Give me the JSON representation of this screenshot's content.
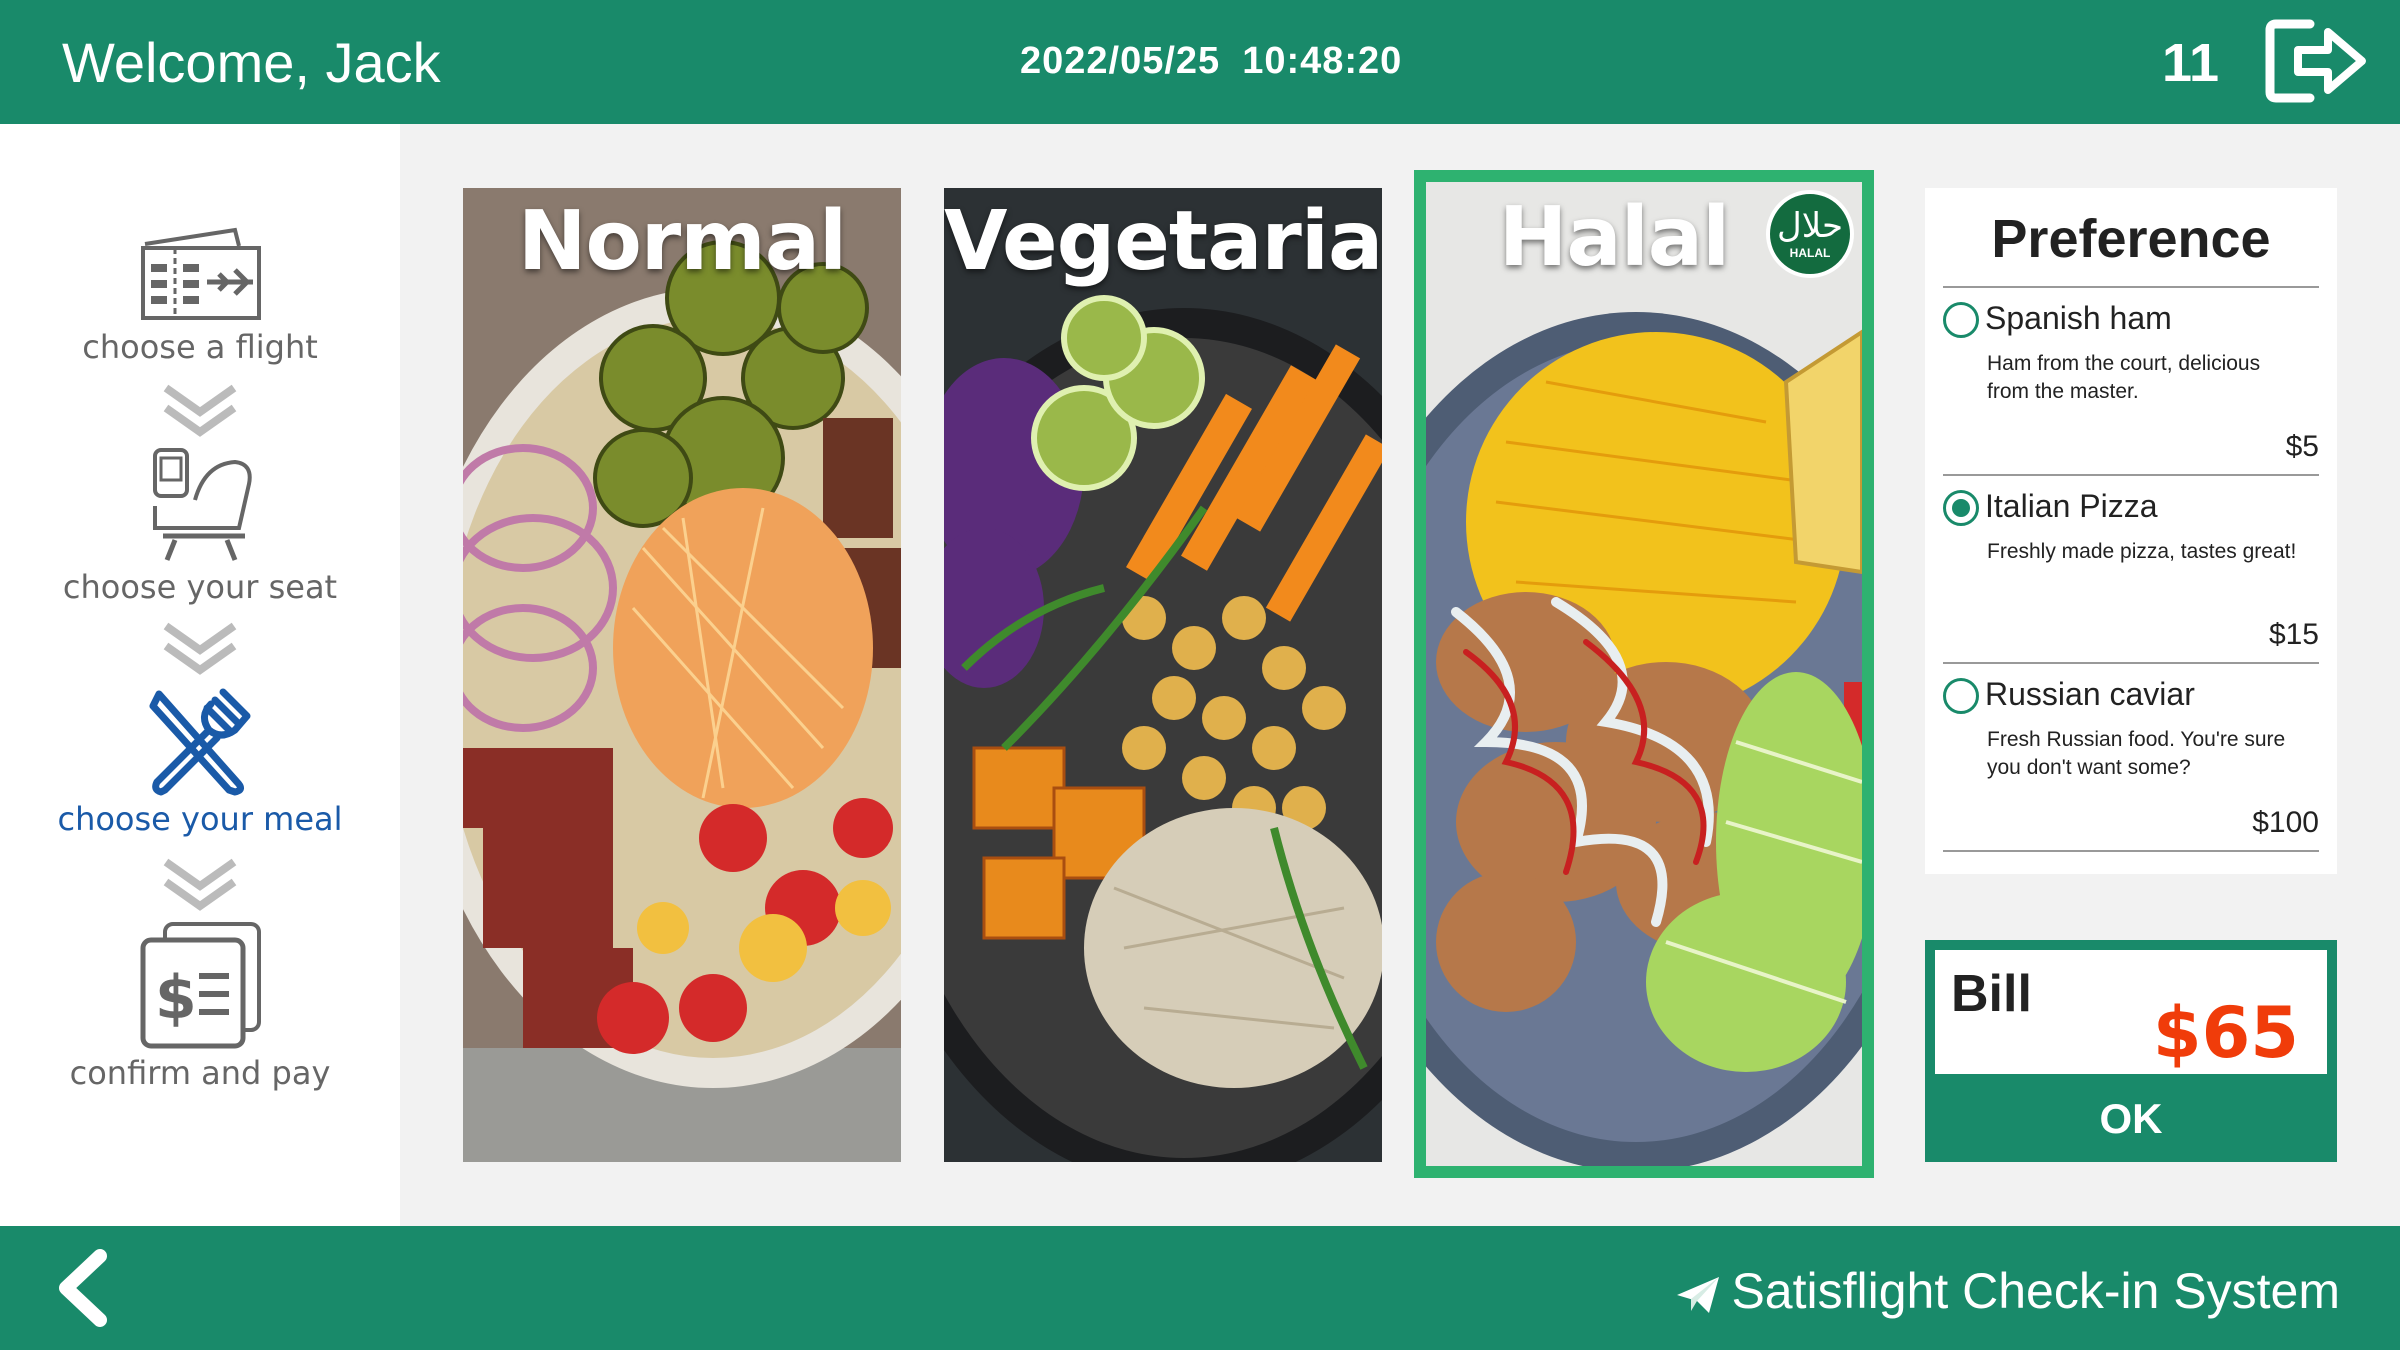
{
  "header": {
    "welcome": "Welcome, Jack",
    "date": "2022/05/25",
    "time": "10:48:20",
    "counter": "11",
    "logout_icon": "logout-icon"
  },
  "steps": [
    {
      "label": "choose a flight",
      "icon": "ticket-icon",
      "active": false
    },
    {
      "label": "choose your seat",
      "icon": "seat-icon",
      "active": false
    },
    {
      "label": "choose your meal",
      "icon": "fork-knife-icon",
      "active": true
    },
    {
      "label": "confirm and pay",
      "icon": "bill-icon",
      "active": false
    }
  ],
  "meals": [
    {
      "title": "Normal",
      "selected": false
    },
    {
      "title": "Vegetarian",
      "selected": false
    },
    {
      "title": "Halal",
      "selected": true,
      "badge_ar": "حلال",
      "badge_en": "HALAL"
    }
  ],
  "preference": {
    "title": "Preference",
    "options": [
      {
        "name": "Spanish ham",
        "desc": "Ham from the court, delicious from the master.",
        "price": "$5",
        "checked": false
      },
      {
        "name": "Italian Pizza",
        "desc": "Freshly made pizza, tastes great!",
        "price": "$15",
        "checked": true
      },
      {
        "name": "Russian caviar",
        "desc": "Fresh Russian food. You're sure you don't want some?",
        "price": "$100",
        "checked": false
      }
    ]
  },
  "bill": {
    "label": "Bill",
    "amount": "$65",
    "ok_label": "OK"
  },
  "footer": {
    "brand": "Satisflight Check-in System"
  },
  "colors": {
    "primary": "#198a6a",
    "selected_outline": "#2eb270",
    "active_step": "#1a5aa8",
    "bill_amount": "#f03c0a"
  }
}
